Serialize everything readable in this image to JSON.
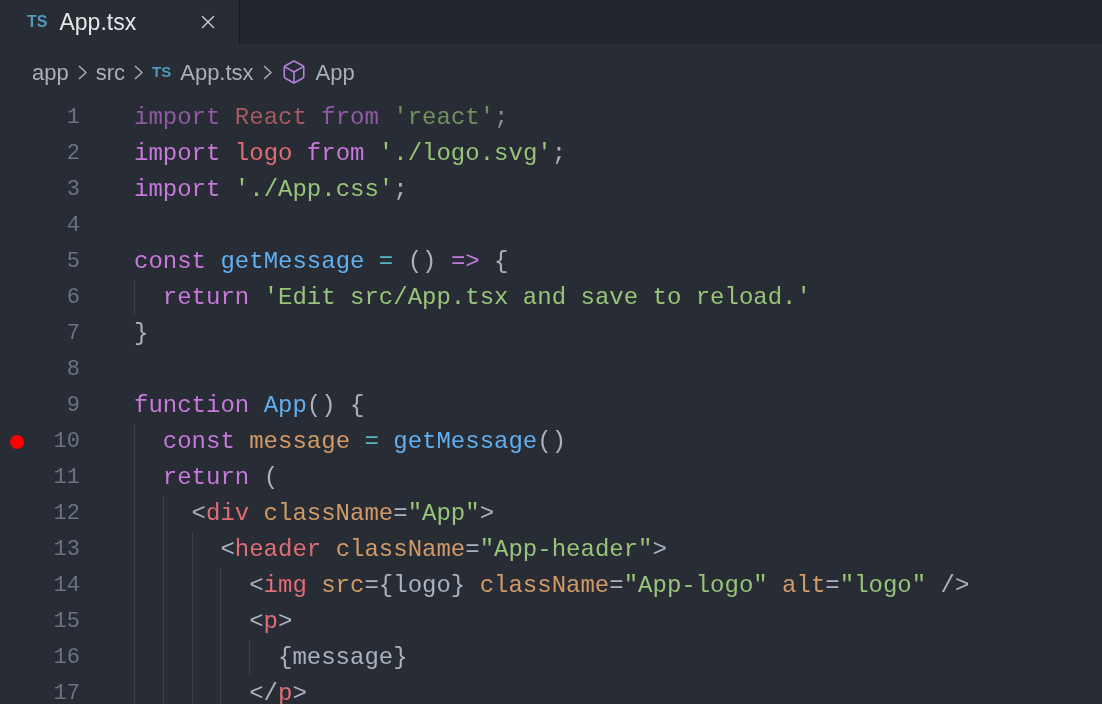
{
  "tabs": [
    {
      "badge": "TS",
      "label": "App.tsx",
      "selected": true
    }
  ],
  "breadcrumb": [
    {
      "kind": "folder",
      "label": "app"
    },
    {
      "kind": "folder",
      "label": "src"
    },
    {
      "kind": "file",
      "badge": "TS",
      "label": "App.tsx"
    },
    {
      "kind": "symbol",
      "label": "App"
    }
  ],
  "lines": [
    {
      "number": "1",
      "breakpoint": false,
      "faded": true,
      "tokens": [
        {
          "kind": "keyword",
          "text": "import "
        },
        {
          "kind": "variable",
          "text": "React "
        },
        {
          "kind": "keyword",
          "text": "from "
        },
        {
          "kind": "string",
          "text": "'react'"
        },
        {
          "kind": "punct",
          "text": ";"
        }
      ]
    },
    {
      "number": "2",
      "breakpoint": false,
      "faded": false,
      "tokens": [
        {
          "kind": "keyword",
          "text": "import "
        },
        {
          "kind": "variable",
          "text": "logo "
        },
        {
          "kind": "keyword",
          "text": "from "
        },
        {
          "kind": "string",
          "text": "'./logo.svg'"
        },
        {
          "kind": "punct",
          "text": ";"
        }
      ]
    },
    {
      "number": "3",
      "breakpoint": false,
      "faded": false,
      "tokens": [
        {
          "kind": "keyword",
          "text": "import "
        },
        {
          "kind": "string",
          "text": "'./App.css'"
        },
        {
          "kind": "punct",
          "text": ";"
        }
      ]
    },
    {
      "number": "4",
      "breakpoint": false
    },
    {
      "number": "5",
      "breakpoint": false,
      "faded": false,
      "tokens": [
        {
          "kind": "keyword",
          "text": "const "
        },
        {
          "kind": "function",
          "text": "getMessage "
        },
        {
          "kind": "operator",
          "text": "= "
        },
        {
          "kind": "punct",
          "text": "() "
        },
        {
          "kind": "keyword",
          "text": "=> "
        },
        {
          "kind": "punct",
          "text": "{"
        }
      ],
      "children": [
        {
          "number": "6",
          "breakpoint": false,
          "faded": false,
          "tokens": [
            {
              "kind": "keyword",
              "text": "return "
            },
            {
              "kind": "string",
              "text": "'Edit src/App.tsx and save to reload.'"
            }
          ]
        }
      ]
    },
    {
      "number": "7",
      "breakpoint": false,
      "faded": false,
      "tokens": [
        {
          "kind": "punct",
          "text": "}"
        }
      ]
    },
    {
      "number": "8",
      "breakpoint": false
    },
    {
      "number": "9",
      "breakpoint": false,
      "faded": false,
      "tokens": [
        {
          "kind": "keyword",
          "text": "function "
        },
        {
          "kind": "function",
          "text": "App"
        },
        {
          "kind": "punct",
          "text": "() {"
        }
      ],
      "children": [
        {
          "number": "10",
          "breakpoint": true,
          "faded": false,
          "tokens": [
            {
              "kind": "keyword",
              "text": "const "
            },
            {
              "kind": "attr",
              "text": "message "
            },
            {
              "kind": "operator",
              "text": "= "
            },
            {
              "kind": "function",
              "text": "getMessage"
            },
            {
              "kind": "punct",
              "text": "()"
            }
          ]
        },
        {
          "number": "11",
          "breakpoint": false,
          "faded": false,
          "tokens": [
            {
              "kind": "keyword",
              "text": "return "
            },
            {
              "kind": "punct",
              "text": "("
            }
          ],
          "children": [
            {
              "number": "12",
              "breakpoint": false,
              "faded": false,
              "tokens": [
                {
                  "kind": "punct",
                  "text": "<"
                },
                {
                  "kind": "tag",
                  "text": "div "
                },
                {
                  "kind": "attr",
                  "text": "className"
                },
                {
                  "kind": "punct",
                  "text": "="
                },
                {
                  "kind": "string",
                  "text": "\"App\""
                },
                {
                  "kind": "punct",
                  "text": ">"
                }
              ],
              "children": [
                {
                  "number": "13",
                  "breakpoint": false,
                  "faded": false,
                  "tokens": [
                    {
                      "kind": "punct",
                      "text": "<"
                    },
                    {
                      "kind": "tag",
                      "text": "header "
                    },
                    {
                      "kind": "attr",
                      "text": "className"
                    },
                    {
                      "kind": "punct",
                      "text": "="
                    },
                    {
                      "kind": "string",
                      "text": "\"App-header\""
                    },
                    {
                      "kind": "punct",
                      "text": ">"
                    }
                  ],
                  "children": [
                    {
                      "number": "14",
                      "breakpoint": false,
                      "faded": false,
                      "tokens": [
                        {
                          "kind": "punct",
                          "text": "<"
                        },
                        {
                          "kind": "tag",
                          "text": "img "
                        },
                        {
                          "kind": "attr",
                          "text": "src"
                        },
                        {
                          "kind": "punct",
                          "text": "={logo} "
                        },
                        {
                          "kind": "attr",
                          "text": "className"
                        },
                        {
                          "kind": "punct",
                          "text": "="
                        },
                        {
                          "kind": "string",
                          "text": "\"App-logo\" "
                        },
                        {
                          "kind": "attr",
                          "text": "alt"
                        },
                        {
                          "kind": "punct",
                          "text": "="
                        },
                        {
                          "kind": "string",
                          "text": "\"logo\" "
                        },
                        {
                          "kind": "punct",
                          "text": "/>"
                        }
                      ]
                    },
                    {
                      "number": "15",
                      "breakpoint": false,
                      "faded": false,
                      "tokens": [
                        {
                          "kind": "punct",
                          "text": "<"
                        },
                        {
                          "kind": "tag",
                          "text": "p"
                        },
                        {
                          "kind": "punct",
                          "text": ">"
                        }
                      ],
                      "children": [
                        {
                          "number": "16",
                          "breakpoint": false,
                          "faded": false,
                          "tokens": [
                            {
                              "kind": "punct",
                              "text": "{message}"
                            }
                          ]
                        }
                      ]
                    },
                    {
                      "number": "17",
                      "breakpoint": false,
                      "faded": false,
                      "tokens": [
                        {
                          "kind": "punct",
                          "text": "</"
                        },
                        {
                          "kind": "tag",
                          "text": "p"
                        },
                        {
                          "kind": "punct",
                          "text": ">"
                        }
                      ]
                    }
                  ]
                }
              ]
            }
          ]
        }
      ]
    }
  ]
}
